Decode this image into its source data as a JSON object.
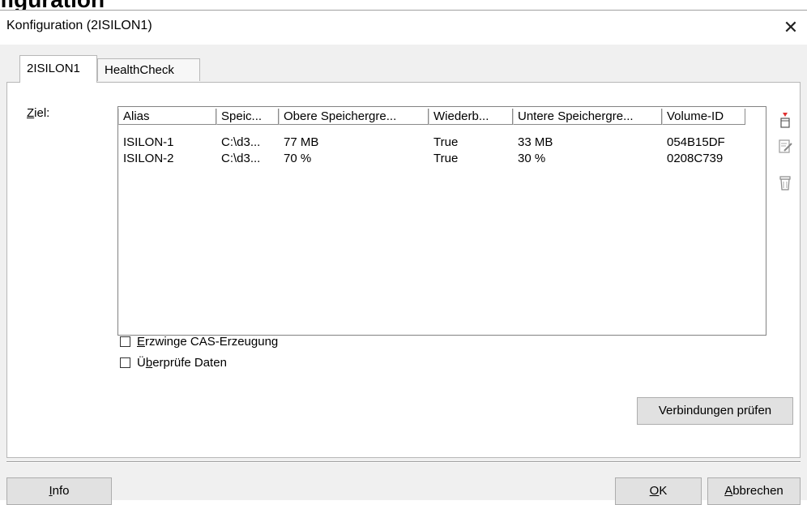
{
  "window": {
    "title": "Konfiguration (2ISILON1)",
    "close_glyph": "✕",
    "background_fragment": "figuration"
  },
  "tabs": [
    {
      "label": "2ISILON1",
      "active": true
    },
    {
      "label": "HealthCheck",
      "active": false
    }
  ],
  "ziel": {
    "prefix": "Z",
    "rest": "iel:"
  },
  "listview": {
    "columns": [
      "Alias",
      "Speic...",
      "Obere Speichergre...",
      "Wiederb...",
      "Untere Speichergre...",
      "Volume-ID"
    ],
    "rows": [
      [
        "ISILON-1",
        "C:\\d3...",
        "77 MB",
        "True",
        "33 MB",
        "054B15DF"
      ],
      [
        "ISILON-2",
        "C:\\d3...",
        "70 %",
        "True",
        "30 %",
        "0208C739"
      ]
    ]
  },
  "side_icons": [
    "new-item-icon",
    "edit-item-icon",
    "delete-item-icon"
  ],
  "checkboxes": [
    {
      "accel": "E",
      "rest": "rzwinge CAS-Erzeugung",
      "checked": false
    },
    {
      "pre": "Ü",
      "accel": "b",
      "rest": "erprüfe Daten",
      "checked": false
    }
  ],
  "buttons": {
    "verbindungen": "Verbindungen prüfen",
    "info_accel": "I",
    "info_rest": "nfo",
    "ok_accel": "O",
    "ok_rest": "K",
    "abbrechen_accel": "A",
    "abbrechen_rest": "bbrechen"
  },
  "colors": {
    "accent_red": "#e03030"
  }
}
